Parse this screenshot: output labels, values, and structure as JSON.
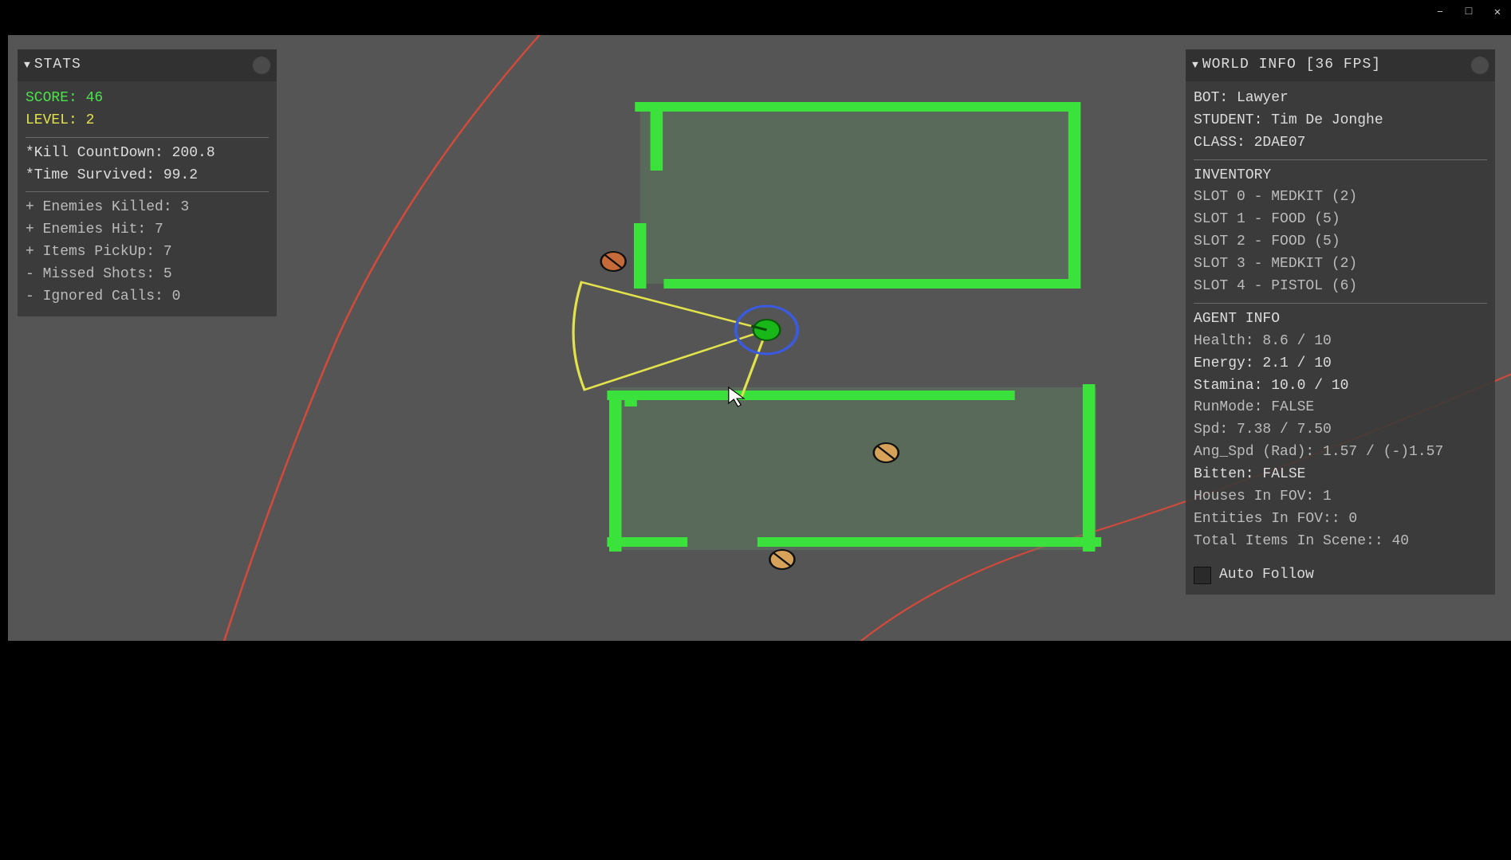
{
  "window": {
    "minimize": "–",
    "maximize": "□",
    "close": "✕"
  },
  "stats": {
    "header": "STATS",
    "score_label": "SCORE:",
    "score_value": "46",
    "level_label": "LEVEL:",
    "level_value": "2",
    "kill_countdown": "*Kill CountDown: 200.8",
    "time_survived": "*Time Survived: 99.2",
    "enemies_killed": "+ Enemies Killed: 3",
    "enemies_hit": "+ Enemies Hit: 7",
    "items_pickup": "+ Items PickUp: 7",
    "missed_shots": "- Missed Shots: 5",
    "ignored_calls": "- Ignored Calls: 0"
  },
  "world": {
    "header": "WORLD INFO [36 FPS]",
    "bot": "BOT: Lawyer",
    "student": "STUDENT: Tim De Jonghe",
    "class": "CLASS: 2DAE07",
    "inventory_label": "INVENTORY",
    "slot0": "SLOT 0 - MEDKIT (2)",
    "slot1": "SLOT 1 - FOOD (5)",
    "slot2": "SLOT 2 - FOOD (5)",
    "slot3": "SLOT 3 - MEDKIT (2)",
    "slot4": "SLOT 4 - PISTOL (6)",
    "agent_label": "AGENT INFO",
    "health": "Health: 8.6 / 10",
    "energy": "Energy: 2.1 / 10",
    "stamina": "Stamina: 10.0 / 10",
    "runmode": "RunMode: FALSE",
    "spd": "Spd: 7.38 / 7.50",
    "ang_spd": "Ang_Spd (Rad): 1.57 / (-)1.57",
    "bitten": "Bitten: FALSE",
    "houses_fov": "Houses In FOV: 1",
    "entities_fov": "Entities In FOV:: 0",
    "total_items": "Total Items In Scene:: 40",
    "auto_follow": "Auto Follow"
  }
}
